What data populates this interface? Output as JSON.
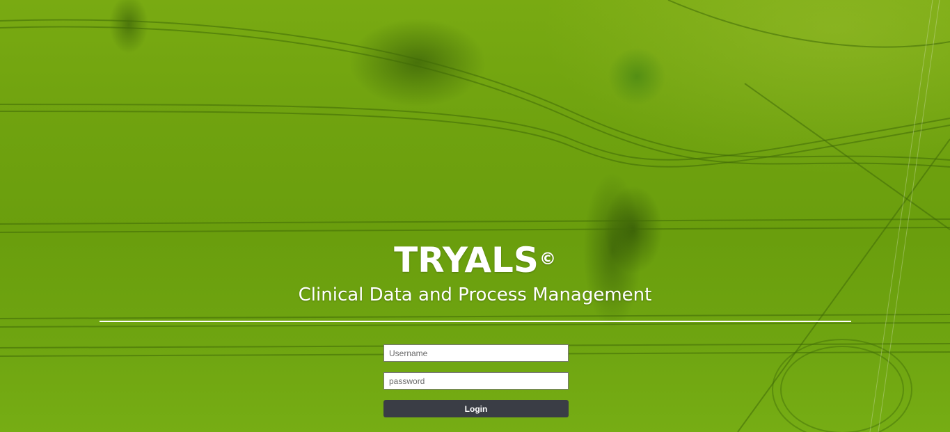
{
  "brand": {
    "name": "TRYALS",
    "mark": "©",
    "tagline": "Clinical Data and Process Management"
  },
  "login": {
    "username_placeholder": "Username",
    "username_value": "",
    "password_placeholder": "password",
    "password_value": "",
    "button_label": "Login"
  },
  "colors": {
    "field_green": "#6fa20f",
    "button_bg": "#3a3d45",
    "text": "#ffffff"
  }
}
